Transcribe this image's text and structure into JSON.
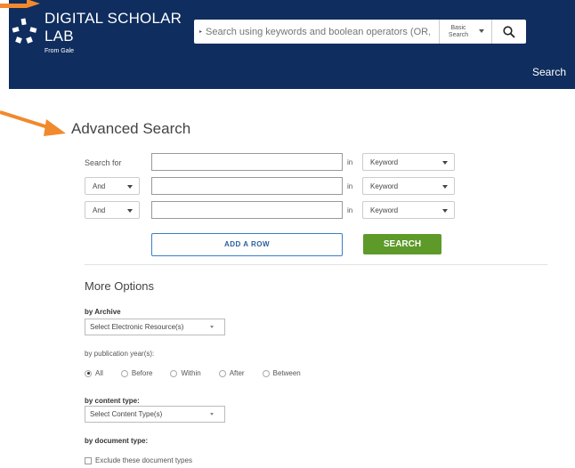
{
  "header": {
    "logo_line1": "DIGITAL SCHOLAR",
    "logo_line2": "LAB",
    "logo_sub": "From Gale",
    "search_placeholder": "Search using keywords and boolean operators (OR, AND, NOT)",
    "search_type_label": "Basic Search",
    "search_link": "Search"
  },
  "colors": {
    "header_bg": "#0f2d5e",
    "accent_orange": "#f08a2c",
    "search_green": "#5d9a2a",
    "add_row_blue": "#3a7fc4"
  },
  "main": {
    "title": "Advanced Search",
    "search_for_label": "Search for",
    "rows": [
      {
        "operator": "",
        "term": "",
        "in_label": "in",
        "field": "Keyword"
      },
      {
        "operator": "And",
        "term": "",
        "in_label": "in",
        "field": "Keyword"
      },
      {
        "operator": "And",
        "term": "",
        "in_label": "in",
        "field": "Keyword"
      }
    ],
    "add_row_label": "ADD A ROW",
    "search_button_label": "SEARCH"
  },
  "more_options": {
    "title": "More Options",
    "by_archive_label": "by Archive",
    "archive_select": "Select Electronic Resource(s)",
    "by_pub_year_label": "by publication year(s):",
    "pub_year_options": [
      "All",
      "Before",
      "Within",
      "After",
      "Between"
    ],
    "pub_year_selected": "All",
    "by_content_type_label": "by content type:",
    "content_type_select": "Select Content Type(s)",
    "by_document_type_label": "by document type:",
    "exclude_label": "Exclude these document types"
  }
}
